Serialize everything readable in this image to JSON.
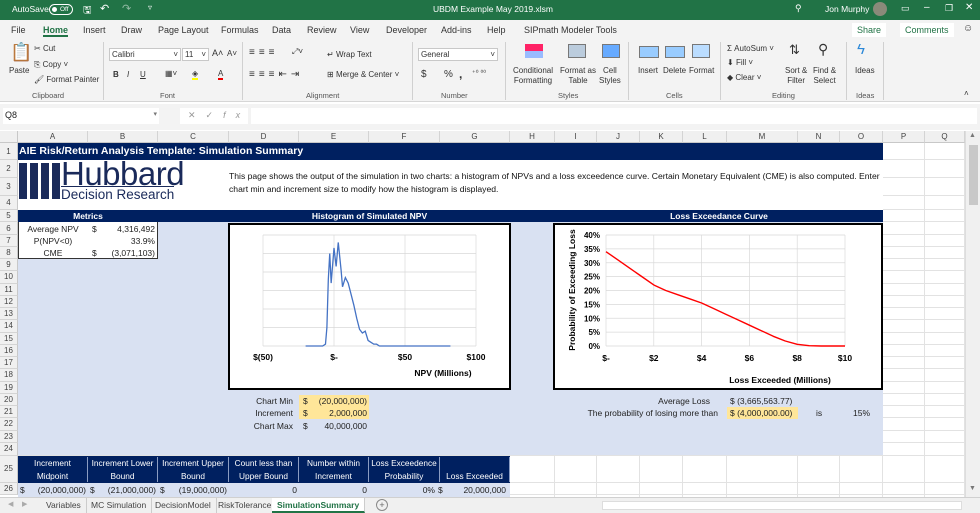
{
  "titlebar": {
    "autosave_label": "AutoSave",
    "autosave_state": "Off",
    "filename": "UBDM Example May 2019.xlsm",
    "user": "Jon Murphy",
    "color": "#217346"
  },
  "menu": {
    "tabs": [
      "File",
      "Home",
      "Insert",
      "Draw",
      "Page Layout",
      "Formulas",
      "Data",
      "Review",
      "View",
      "Developer",
      "Add-ins",
      "Help",
      "SIPmath Modeler Tools"
    ],
    "active": "Home",
    "share": "Share",
    "comments": "Comments"
  },
  "ribbon": {
    "clipboard": {
      "paste": "Paste",
      "cut": "Cut",
      "copy": "Copy",
      "format_painter": "Format Painter",
      "label": "Clipboard"
    },
    "font": {
      "name": "Calibri",
      "size": "11",
      "bold": "B",
      "italic": "I",
      "underline": "U",
      "label": "Font"
    },
    "alignment": {
      "wrap": "Wrap Text",
      "merge": "Merge & Center",
      "label": "Alignment"
    },
    "number": {
      "format": "General",
      "currency": "$",
      "percent": "%",
      "comma": ",",
      "label": "Number"
    },
    "styles": {
      "conditional": [
        "Conditional",
        "Formatting"
      ],
      "table": [
        "Format as",
        "Table"
      ],
      "cell": [
        "Cell",
        "Styles"
      ],
      "label": "Styles"
    },
    "cells": {
      "insert": "Insert",
      "delete": "Delete",
      "format": "Format",
      "label": "Cells"
    },
    "editing": {
      "autosum": "AutoSum",
      "fill": "Fill",
      "clear": "Clear",
      "sort": [
        "Sort &",
        "Filter"
      ],
      "find": [
        "Find &",
        "Select"
      ],
      "label": "Editing"
    },
    "ideas": {
      "button": "Ideas",
      "label": "Ideas"
    }
  },
  "formula_bar": {
    "name_box": "Q8",
    "formula": ""
  },
  "columns": [
    "A",
    "B",
    "C",
    "D",
    "E",
    "F",
    "G",
    "H",
    "I",
    "J",
    "K",
    "L",
    "M",
    "N",
    "O",
    "P",
    "Q"
  ],
  "rows": [
    "1",
    "2",
    "3",
    "4",
    "5",
    "6",
    "7",
    "8",
    "9",
    "10",
    "11",
    "12",
    "13",
    "14",
    "15",
    "16",
    "17",
    "18",
    "19",
    "20",
    "21",
    "22",
    "23",
    "24",
    "25",
    "26"
  ],
  "sheet": {
    "title": "AIE Risk/Return Analysis Template: Simulation Summary",
    "logo": {
      "line1": "Hubbard",
      "line2": "Decision Research"
    },
    "description": "This page shows the output of the simulation in two charts: a histogram of NPVs and a loss exceedence curve.  Certain Monetary Equivalent (CME) is also computed. Enter chart min and increment size to modify how the histogram is displayed.",
    "metrics": {
      "header": "Metrics",
      "rows": [
        {
          "label": "Average NPV",
          "cur": "$",
          "value": "4,316,492"
        },
        {
          "label": "P(NPV<0)",
          "cur": "",
          "value": "33.9%"
        },
        {
          "label": "CME",
          "cur": "$",
          "value": "(3,071,103)"
        }
      ]
    },
    "histogram_header": "Histogram of Simulated NPV",
    "loss_header": "Loss Exceedance Curve",
    "inputs": [
      {
        "label": "Chart Min",
        "cur": "$",
        "value": "(20,000,000)",
        "input": true
      },
      {
        "label": "Increment",
        "cur": "$",
        "value": "2,000,000",
        "input": true
      },
      {
        "label": "Chart Max",
        "cur": "$",
        "value": "40,000,000",
        "input": false
      }
    ],
    "loss_summary": {
      "avg_label": "Average Loss",
      "avg_value": "$ (3,665,563.77)",
      "prob_label": "The probability of losing more than",
      "prob_threshold": "$ (4,000,000.00)",
      "is": "is",
      "prob_value": "15%"
    },
    "table": {
      "headers": [
        [
          "Increment",
          "Midpoint"
        ],
        [
          "Increment Lower",
          "Bound"
        ],
        [
          "Increment Upper",
          "Bound"
        ],
        [
          "Count less than",
          "Upper Bound"
        ],
        [
          "Number within",
          "Increment"
        ],
        [
          "Loss Exceedence",
          "Probability"
        ],
        [
          "",
          "Loss Exceeded"
        ]
      ],
      "row26": [
        "$",
        "(20,000,000)",
        "$",
        "(21,000,000)",
        "$",
        "(19,000,000)",
        "0",
        "0",
        "0%",
        "$",
        "20,000,000"
      ]
    },
    "colors": {
      "navy": "#002060",
      "light_blue": "#D9E1F2",
      "input_yellow": "#FFE699"
    }
  },
  "chart_data": [
    {
      "type": "line",
      "title": "",
      "xlabel": "NPV (Millions)",
      "ylabel": "",
      "xlim": [
        -50,
        100
      ],
      "xticks": [
        "$(50)",
        "$-",
        "$50",
        "$100"
      ],
      "xtick_values": [
        -50,
        0,
        50,
        100
      ],
      "y_gridlines": 6,
      "grid": true,
      "color": "#4472C4",
      "x": [
        -20,
        -8,
        -6,
        -5,
        -4,
        -3,
        -2,
        0,
        1.5,
        3,
        5,
        6,
        8,
        10,
        12,
        14,
        16,
        18,
        20,
        22,
        24,
        26,
        28,
        30,
        32,
        40,
        60,
        82
      ],
      "y": [
        0,
        0,
        0.1,
        1,
        3.6,
        5,
        3.4,
        5.3,
        4.3,
        5.6,
        4.1,
        3.2,
        3.7,
        3.4,
        2.8,
        2.2,
        1.5,
        0.9,
        0.7,
        0.8,
        0.3,
        0.2,
        0.1,
        0.1,
        0,
        0,
        0,
        0
      ]
    },
    {
      "type": "line",
      "title": "",
      "xlabel": "Loss Exceeded (Millions)",
      "ylabel": "Probability of Exceeding Loss",
      "xlim": [
        0,
        10
      ],
      "ylim": [
        0,
        40
      ],
      "xticks": [
        "$-",
        "$2",
        "$4",
        "$6",
        "$8",
        "$10"
      ],
      "xtick_values": [
        0,
        2,
        4,
        6,
        8,
        10
      ],
      "yticks": [
        "0%",
        "5%",
        "10%",
        "15%",
        "20%",
        "25%",
        "30%",
        "35%",
        "40%"
      ],
      "ytick_values": [
        0,
        5,
        10,
        15,
        20,
        25,
        30,
        35,
        40
      ],
      "grid": true,
      "color": "#FF0000",
      "x": [
        0,
        0.5,
        1,
        1.5,
        2,
        2.5,
        3,
        3.5,
        4,
        4.5,
        5,
        5.5,
        6,
        6.5,
        7,
        7.5,
        8,
        8.5,
        9,
        10
      ],
      "y": [
        34,
        31,
        28,
        25,
        22,
        20,
        18.5,
        17,
        15.5,
        13.5,
        11.5,
        9.5,
        7.5,
        5.5,
        3.5,
        1.8,
        0.6,
        0.1,
        0,
        0
      ]
    }
  ],
  "sheet_tabs": {
    "tabs": [
      "Variables",
      "MC Simulation",
      "DecisionModel",
      "RiskTolerance",
      "SimulationSummary"
    ],
    "active": "SimulationSummary",
    "add": "+"
  }
}
